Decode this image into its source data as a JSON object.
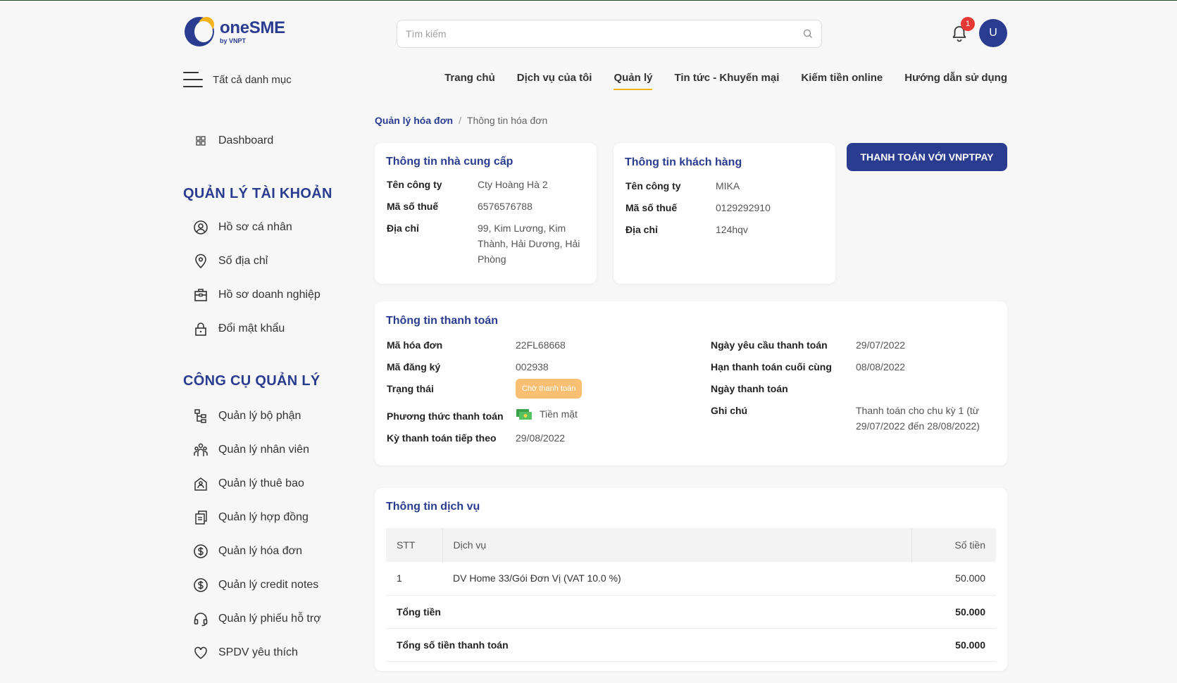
{
  "brand": {
    "name": "oneSME",
    "sub": "by VNPT",
    "primary": "#2a3c8f",
    "accent": "#f2b31b"
  },
  "search": {
    "placeholder": "Tìm kiếm"
  },
  "notifications": {
    "count": "1"
  },
  "user": {
    "initial": "U"
  },
  "all_categories": "Tất cả danh mục",
  "nav": [
    "Trang chủ",
    "Dịch vụ của tôi",
    "Quản lý",
    "Tin tức - Khuyến mại",
    "Kiếm tiền online",
    "Hướng dẫn sử dụng"
  ],
  "nav_active": "Quản lý",
  "sidebar": {
    "dashboard": "Dashboard",
    "account_heading": "QUẢN LÝ TÀI KHOẢN",
    "account_items": [
      "Hồ sơ cá nhân",
      "Số địa chỉ",
      "Hồ sơ doanh nghiệp",
      "Đổi mật khẩu"
    ],
    "tools_heading": "CÔNG CỤ QUẢN LÝ",
    "tools_items": [
      "Quản lý bộ phận",
      "Quản lý nhân viên",
      "Quản lý thuê bao",
      "Quản lý hợp đồng",
      "Quản lý hóa đơn",
      "Quản lý credit notes",
      "Quản lý phiếu hỗ trợ",
      "SPDV yêu thích"
    ]
  },
  "breadcrumb": {
    "parent": "Quản lý hóa đơn",
    "current": "Thông tin hóa đơn"
  },
  "pay_button": "THANH TOÁN VỚI VNPTPAY",
  "supplier": {
    "title": "Thông tin nhà cung cấp",
    "company_label": "Tên công ty",
    "company": "Cty Hoàng Hà 2",
    "tax_label": "Mã số thuế",
    "tax": "6576576788",
    "address_label": "Địa chỉ",
    "address": "99, Kim Lương, Kim Thành, Hải Dương, Hải Phòng"
  },
  "customer": {
    "title": "Thông tin khách hàng",
    "company_label": "Tên công ty",
    "company": "MIKA",
    "tax_label": "Mã số thuế",
    "tax": "0129292910",
    "address_label": "Địa chỉ",
    "address": "124hqv"
  },
  "payment": {
    "title": "Thông tin thanh toán",
    "invoice_label": "Mã hóa đơn",
    "invoice": "22FL68668",
    "reg_label": "Mã đăng ký",
    "reg": "002938",
    "status_label": "Trạng thái",
    "status": "Chờ thanh toán",
    "method_label": "Phương thức thanh toán",
    "method": "Tiền mặt",
    "next_label": "Kỳ thanh toán tiếp theo",
    "next": "29/08/2022",
    "request_date_label": "Ngày yêu cầu thanh toán",
    "request_date": "29/07/2022",
    "due_label": "Hạn thanh toán cuối cùng",
    "due": "08/08/2022",
    "paid_date_label": "Ngày thanh toán",
    "paid_date": "",
    "note_label": "Ghi chú",
    "note": "Thanh toán cho chu kỳ 1 (từ 29/07/2022 đến 28/08/2022)"
  },
  "service": {
    "title": "Thông tin dịch vụ",
    "headers": [
      "STT",
      "Dịch vụ",
      "Số tiền"
    ],
    "rows": [
      {
        "stt": "1",
        "name": "DV Home 33/Gói Đơn Vị (VAT 10.0 %)",
        "amount": "50.000"
      }
    ],
    "total_label": "Tổng tiền",
    "total": "50.000",
    "grand_label": "Tổng số tiền thanh toán",
    "grand": "50.000"
  }
}
